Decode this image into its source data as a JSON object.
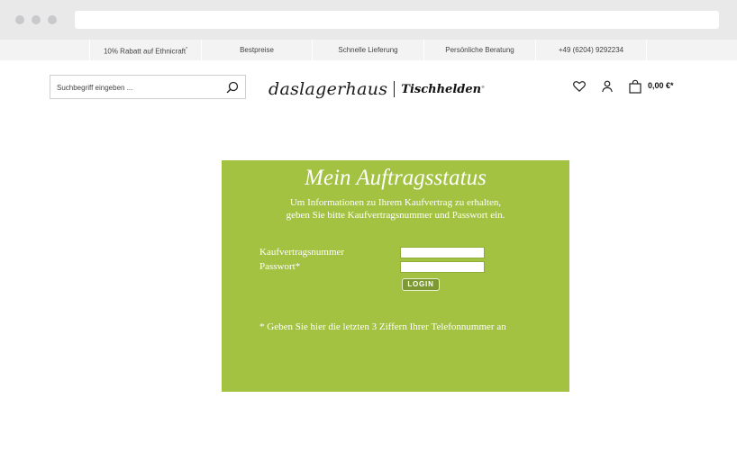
{
  "topbar": {
    "items": [
      {
        "label": "10% Rabatt auf Ethnicraft",
        "mark": "*"
      },
      {
        "label": "Bestpreise"
      },
      {
        "label": "Schnelle Lieferung"
      },
      {
        "label": "Persönliche Beratung"
      },
      {
        "label": "+49 (6204) 9292234"
      }
    ]
  },
  "header": {
    "search_placeholder": "Suchbegriff eingeben ...",
    "search_icon": "search-icon",
    "logo_main": "daslagerhaus",
    "logo_secondary": "Tischhelden",
    "logo_secondary_mark": "®",
    "icons": [
      "heart-icon",
      "user-icon",
      "shopping-bag-icon"
    ],
    "cart_total": "0,00 €*"
  },
  "order_status": {
    "title": "Mein Auftragsstatus",
    "description_line1": "Um Informationen zu Ihrem Kaufvertrag zu erhalten,",
    "description_line2": "geben Sie bitte Kaufvertragsnummer und Passwort ein.",
    "contract_label": "Kaufvertragsnummer",
    "contract_value": "",
    "password_label": "Passwort*",
    "password_value": "",
    "login_label": "LOGIN",
    "footnote": "* Geben Sie hier die letzten 3 Ziffern Ihrer Telefonnummer an"
  },
  "colors": {
    "panel_background": "#a3c242",
    "login_button": "#7d9a32",
    "topbar_background": "#f3f3f3"
  }
}
